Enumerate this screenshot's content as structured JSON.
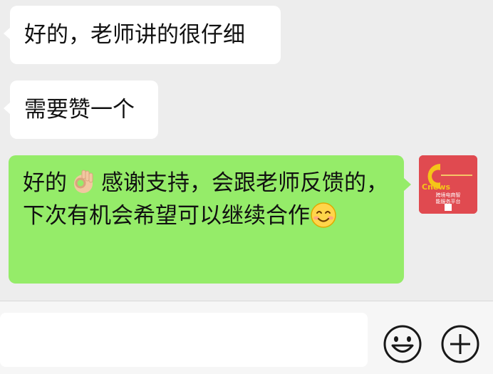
{
  "messages": [
    {
      "direction": "incoming",
      "text": "好的，老师讲的很仔细"
    },
    {
      "direction": "incoming",
      "text": "需要赞一个"
    },
    {
      "direction": "outgoing",
      "text_before_emoji": "好的",
      "emoji_1": "ok-hand-emoji",
      "text_after_emoji": "感谢支持，会跟老师反馈的，下次有机会希望可以继续合作",
      "emoji_2": "smiling-face-emoji"
    }
  ],
  "avatar": {
    "letter": "C",
    "brand": "Cnews",
    "line1": "跨境电商智",
    "line2": "能服务平台",
    "bg_color": "#e04a50",
    "accent_color": "#f5c518"
  },
  "input_bar": {
    "value": "",
    "emoji_button_icon": "smiley-face-icon",
    "more_button_icon": "plus-circle-icon"
  },
  "colors": {
    "chat_bg": "#ededed",
    "incoming_bubble": "#ffffff",
    "outgoing_bubble": "#95ec69"
  }
}
